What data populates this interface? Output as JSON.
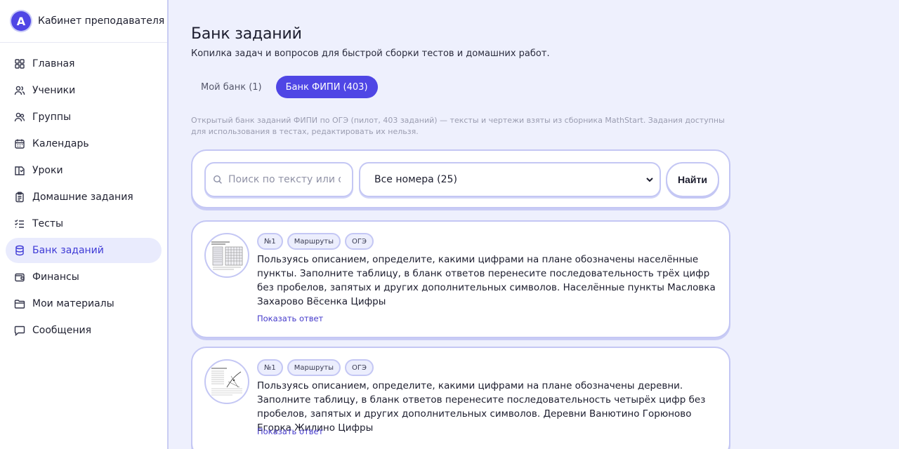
{
  "brand": {
    "logo_letter": "A",
    "title": "Кабинет преподавателя"
  },
  "sidebar": {
    "items": [
      {
        "label": "Главная",
        "icon": "grid-icon"
      },
      {
        "label": "Ученики",
        "icon": "user-icon"
      },
      {
        "label": "Группы",
        "icon": "users-icon"
      },
      {
        "label": "Календарь",
        "icon": "calendar-icon"
      },
      {
        "label": "Уроки",
        "icon": "book-icon"
      },
      {
        "label": "Домашние задания",
        "icon": "clipboard-icon"
      },
      {
        "label": "Тесты",
        "icon": "checklist-icon"
      },
      {
        "label": "Банк заданий",
        "icon": "database-icon",
        "active": true
      },
      {
        "label": "Финансы",
        "icon": "wallet-icon"
      },
      {
        "label": "Мои материалы",
        "icon": "folder-icon"
      },
      {
        "label": "Сообщения",
        "icon": "message-icon"
      }
    ]
  },
  "header": {
    "title": "Банк заданий",
    "subtitle": "Копилка задач и вопросов для быстрой сборки тестов и домашних работ."
  },
  "tabs": [
    {
      "label": "Мой банк (1)",
      "active": false
    },
    {
      "label": "Банк ФИПИ (403)",
      "active": true
    }
  ],
  "note": "Открытый банк заданий ФИПИ по ОГЭ (пилот, 403 заданий) — тексты и чертежи взяты из сборника MathStart. Задания доступны для использования в тестах, редактировать их нельзя.",
  "search": {
    "placeholder": "Поиск по тексту или ответу",
    "value": "",
    "select_value": "Все номера (25)",
    "button_label": "Найти"
  },
  "tasks": [
    {
      "chips": [
        "№1",
        "Маршруты",
        "ОГЭ"
      ],
      "text": "Пользуясь описанием, определите, какими цифрами на плане обозначены населённые пункты. Заполните таблицу, в бланк ответов перенесите последовательность трёх цифр без пробелов, запятых и других дополнительных символов. Населённые пункты Масловка Захарово Вёсенка Цифры",
      "answer_link": "Показать ответ"
    },
    {
      "chips": [
        "№1",
        "Маршруты",
        "ОГЭ"
      ],
      "text": "Пользуясь описанием, определите, какими цифрами на плане обозначены деревни. Заполните таблицу, в бланк ответов перенесите последовательность четырёх цифр без пробелов, запятых и других дополнительных символов. Деревни Ванютино Горюново Егорка Жилино Цифры",
      "answer_link": "Показать ответ"
    }
  ],
  "colors": {
    "accent": "#4f46e5",
    "background": "#eef0fd",
    "border": "#c4c7f4"
  }
}
